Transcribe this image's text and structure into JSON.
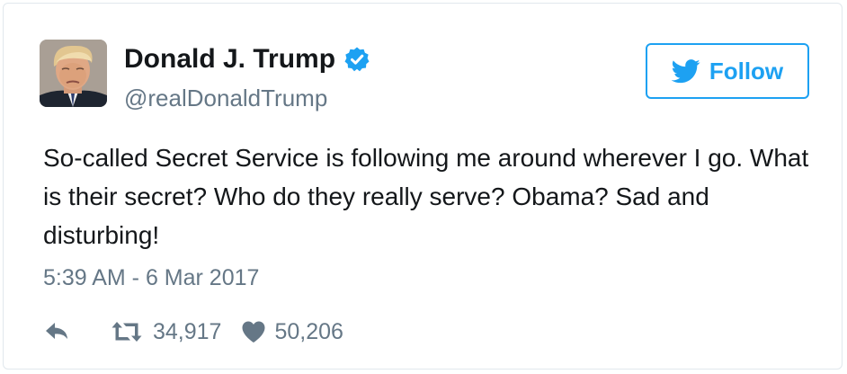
{
  "tweet": {
    "author": {
      "display_name": "Donald J. Trump",
      "handle": "@realDonaldTrump",
      "verified": true,
      "avatar_icon": "profile-photo"
    },
    "follow_button": {
      "label": "Follow",
      "icon": "twitter-bird-icon"
    },
    "text": "So-called Secret Service is following me around wherever I go. What is their secret? Who do they really serve? Obama? Sad and disturbing!",
    "timestamp": "5:39 AM - 6 Mar 2017",
    "actions": {
      "reply": {
        "icon": "reply-icon"
      },
      "retweet": {
        "icon": "retweet-icon",
        "count": "34,917"
      },
      "like": {
        "icon": "heart-icon",
        "count": "50,206"
      }
    }
  },
  "colors": {
    "accent": "#1da1f2",
    "text": "#14171a",
    "secondary": "#657786",
    "border": "#e1e8ed"
  }
}
